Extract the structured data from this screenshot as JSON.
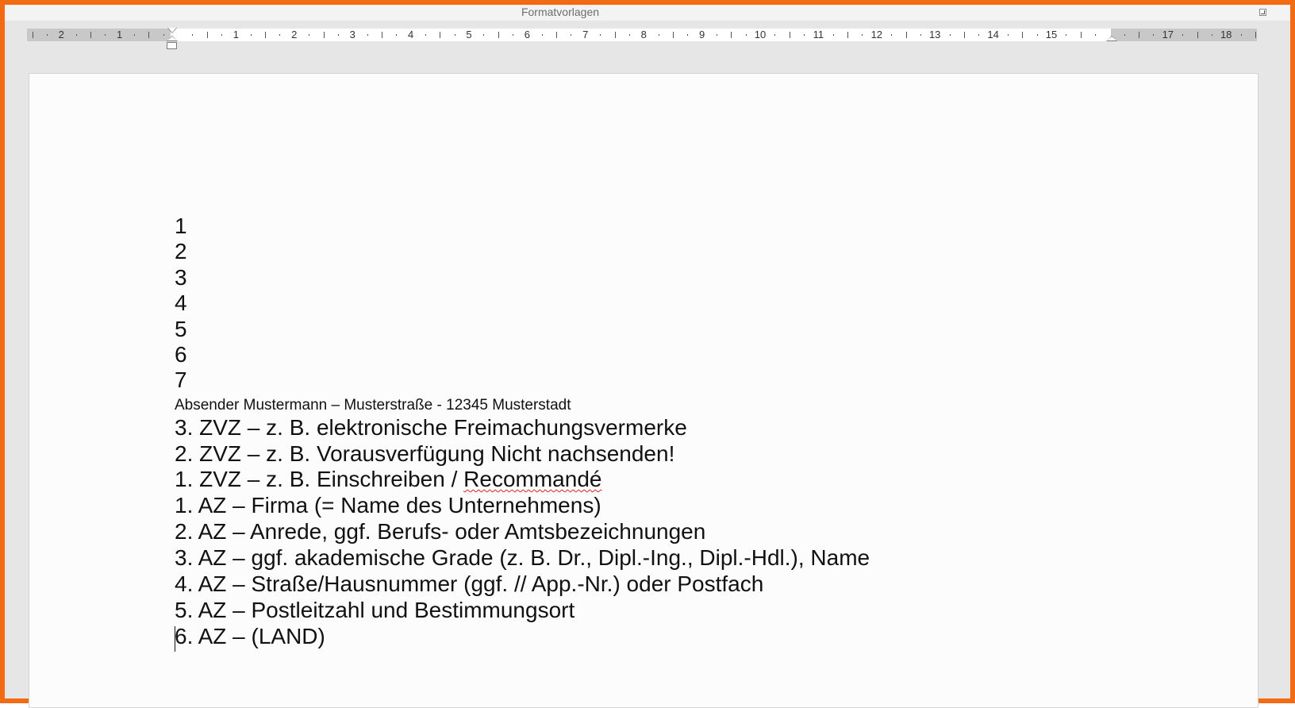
{
  "ribbon": {
    "group_label": "Formatvorlagen",
    "launcher_icon": "dialog-launcher-icon"
  },
  "ruler": {
    "labels": [
      "2",
      "1",
      "1",
      "2",
      "3",
      "4",
      "5",
      "6",
      "7",
      "8",
      "9",
      "10",
      "11",
      "12",
      "13",
      "14",
      "15",
      "17",
      "18"
    ]
  },
  "document": {
    "number_lines": [
      "1",
      "2",
      "3",
      "4",
      "5",
      "6",
      "7"
    ],
    "sender_line": "Absender Mustermann – Musterstraße - 12345 Musterstadt",
    "zvz_lines": [
      "3. ZVZ – z. B. elektronische Freimachungsvermerke",
      "2. ZVZ – z. B. Vorausverfügung Nicht nachsenden!"
    ],
    "zvz1_prefix": "1. ZVZ – z. B. Einschreiben / ",
    "zvz1_flagged_word": "Recommandé",
    "az_lines": [
      "1. AZ – Firma (= Name des Unternehmens)",
      "2. AZ – Anrede, ggf. Berufs- oder Amtsbezeichnungen",
      "3. AZ – ggf. akademische Grade (z. B. Dr., Dipl.-Ing., Dipl.-Hdl.), Name",
      "4. AZ – Straße/Hausnummer (ggf. // App.-Nr.) oder Postfach",
      "5. AZ – Postleitzahl und Bestimmungsort",
      "6. AZ – (LAND)"
    ]
  },
  "colors": {
    "frame_accent": "#f26a12",
    "spell_check_underline": "#d22"
  }
}
